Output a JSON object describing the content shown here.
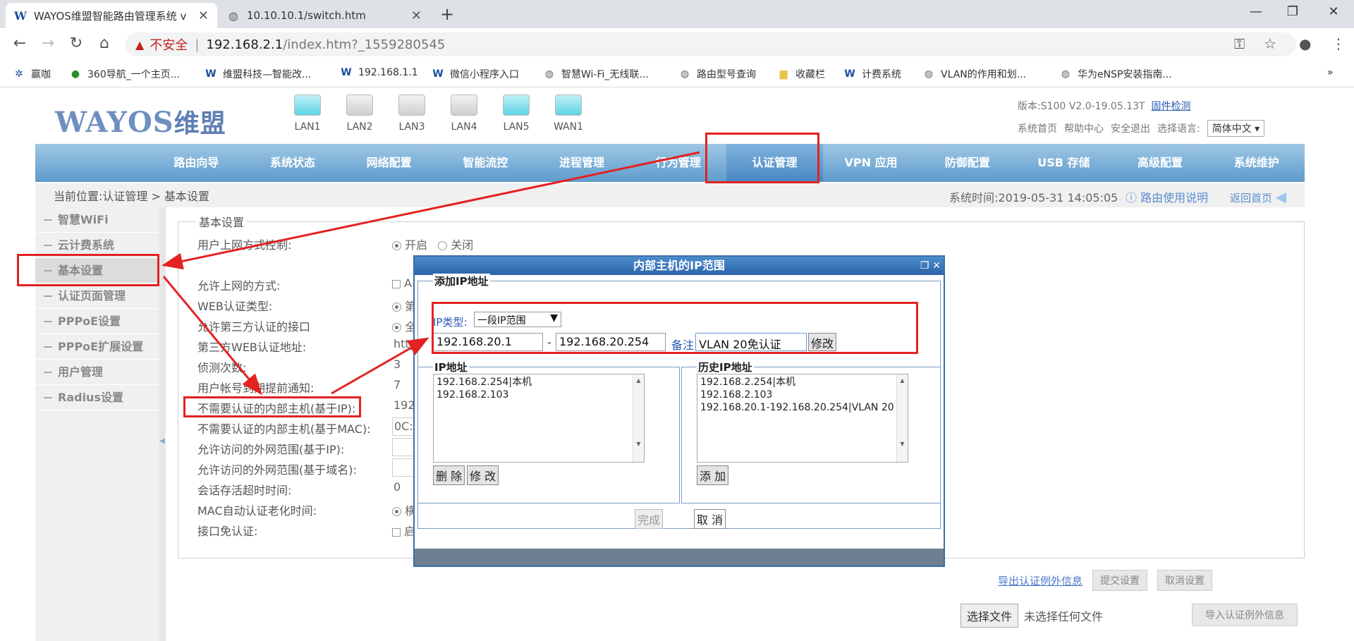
{
  "browser": {
    "tabs": [
      {
        "title": "WAYOS维盟智能路由管理系统 v",
        "icon": "W"
      },
      {
        "title": "10.10.10.1/switch.htm",
        "icon": "globe"
      }
    ],
    "new_tab": "+",
    "url": {
      "insecure_label": "不安全",
      "separator": "|",
      "host": "192.168.2.1",
      "path": "/index.htm?_1559280545"
    },
    "bookmarks": [
      {
        "label": "赢咖",
        "icon": "bee"
      },
      {
        "label": "360导航_一个主页...",
        "icon": "360"
      },
      {
        "label": "维盟科技—智能改...",
        "icon": "W"
      },
      {
        "label": "192.168.1.1",
        "icon": "W"
      },
      {
        "label": "微信小程序入口",
        "icon": "W"
      },
      {
        "label": "智慧Wi-Fi_无线联...",
        "icon": "globe"
      },
      {
        "label": "路由型号查询",
        "icon": "globe"
      },
      {
        "label": "收藏栏",
        "icon": "folder"
      },
      {
        "label": "计费系统",
        "icon": "W"
      },
      {
        "label": "VLAN的作用和划...",
        "icon": "globe"
      },
      {
        "label": "华为eNSP安装指南...",
        "icon": "globe"
      }
    ],
    "more_bookmarks": "»"
  },
  "header": {
    "logo_text": "WAYOS",
    "logo_cn": "维盟",
    "ports": [
      {
        "label": "LAN1",
        "active": true
      },
      {
        "label": "LAN2",
        "active": false
      },
      {
        "label": "LAN3",
        "active": false
      },
      {
        "label": "LAN4",
        "active": false
      },
      {
        "label": "LAN5",
        "active": true
      },
      {
        "label": "WAN1",
        "active": true
      }
    ],
    "version": "版本:S100 V2.0-19.05.13T",
    "firmware_check": "固件检测",
    "links": [
      "系统首页",
      "帮助中心",
      "安全退出"
    ],
    "language_label": "选择语言:",
    "language_value": "简体中文"
  },
  "nav": [
    "路由向导",
    "系统状态",
    "网络配置",
    "智能流控",
    "进程管理",
    "行为管理",
    "认证管理",
    "VPN 应用",
    "防御配置",
    "USB 存储",
    "高级配置",
    "系统维护"
  ],
  "nav_active": "认证管理",
  "breadcrumb": "当前位置:认证管理 > 基本设置",
  "system_time": "系统时间:2019-05-31 14:05:05",
  "help_link": "路由使用说明",
  "home_link": "返回首页",
  "sidebar": [
    "智慧WiFi",
    "云计费系统",
    "基本设置",
    "认证页面管理",
    "PPPoE设置",
    "PPPoE扩展设置",
    "用户管理",
    "Radius设置"
  ],
  "sidebar_selected": "基本设置",
  "content": {
    "title": "基本设置",
    "rows": [
      {
        "label": "用户上网方式控制:",
        "value": ""
      },
      {
        "label": "允许上网的方式:",
        "value": "A"
      },
      {
        "label": "WEB认证类型:",
        "value": "第"
      },
      {
        "label": "允许第三方认证的接口",
        "value": "全"
      },
      {
        "label": "第三方WEB认证地址:",
        "value": "http"
      },
      {
        "label": "侦测次数:",
        "value": "3"
      },
      {
        "label": "用户帐号到期提前通知:",
        "value": "7"
      },
      {
        "label": "不需要认证的内部主机(基于IP):",
        "value": "192"
      },
      {
        "label": "不需要认证的内部主机(基于MAC):",
        "value": "0C:"
      },
      {
        "label": "允许访问的外网范围(基于IP):",
        "value": ""
      },
      {
        "label": "允许访问的外网范围(基于域名):",
        "value": ""
      },
      {
        "label": "会话存活超时时间:",
        "value": "0"
      },
      {
        "label": "MAC自动认证老化时间:",
        "value": "横"
      },
      {
        "label": "接口免认证:",
        "value": "启"
      }
    ],
    "radio_on": "开启",
    "radio_off": "关闭",
    "export_link": "导出认证例外信息",
    "submit_btn": "提交设置",
    "cancel_btn": "取消设置",
    "choose_file_btn": "选择文件",
    "no_file": "未选择任何文件",
    "import_btn": "导入认证例外信息"
  },
  "modal": {
    "title": "内部主机的IP范围",
    "add_legend": "添加IP地址",
    "ip_type_label": "IP类型:",
    "ip_type_value": "一段IP范围",
    "start_ip": "192.168.20.1",
    "dash": "-",
    "end_ip": "192.168.20.254",
    "note_label": "备注",
    "note_value": "VLAN 20免认证",
    "modify_btn": "修改",
    "ip_legend": "IP地址",
    "ip_list": [
      "192.168.2.254|本机",
      "192.168.2.103"
    ],
    "delete_btn": "删 除",
    "modify2_btn": "修 改",
    "history_legend": "历史IP地址",
    "history_list": [
      "192.168.2.254|本机",
      "192.168.2.103",
      "192.168.20.1-192.168.20.254|VLAN 20"
    ],
    "add_btn": "添 加",
    "finish_btn": "完成",
    "cancel_btn": "取 消"
  },
  "colors": {
    "nav_bar": "#5e9ccd",
    "annotation_red": "#e32222",
    "modal_header": "#2d64a8",
    "link_blue": "#2a58b4"
  }
}
